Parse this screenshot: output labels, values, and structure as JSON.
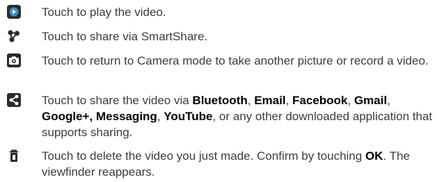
{
  "colors": {
    "text": "#3c3c3c",
    "bold_text": "#000000",
    "icon_background": "#2b2b2b",
    "play_accent": "#3a8fc4"
  },
  "items": [
    {
      "icon": "play-icon",
      "text": "Touch to play the video."
    },
    {
      "icon": "smartshare-icon",
      "text": "Touch to share via SmartShare."
    },
    {
      "icon": "camera-icon",
      "text": "Touch to return to Camera mode to take another picture or record a video."
    },
    {
      "icon": "share-icon",
      "text_parts": [
        "Touch to share the video via ",
        "Bluetooth",
        ", ",
        "Email",
        ", ",
        "Facebook",
        ", ",
        "Gmail",
        ", ",
        "Google+,",
        " ",
        "Messaging",
        ", ",
        "YouTube",
        ", or any other downloaded application that supports sharing."
      ]
    },
    {
      "icon": "delete-icon",
      "text_parts": [
        "Touch to delete the video you just made. Confirm by touching ",
        "OK",
        ". The viewfinder reappears."
      ]
    }
  ]
}
